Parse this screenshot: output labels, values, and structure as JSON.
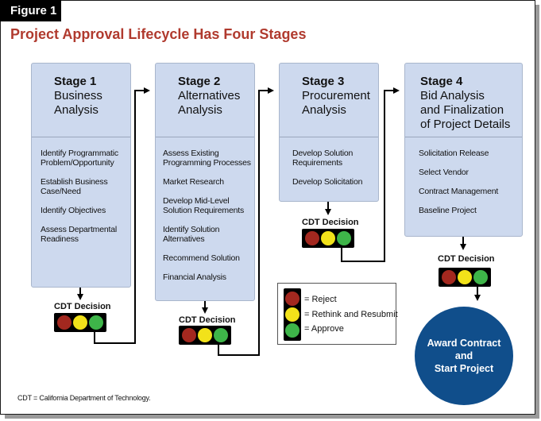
{
  "figure_label": "Figure 1",
  "title": "Project Approval Lifecycle Has Four Stages",
  "stages": [
    {
      "number": "Stage 1",
      "name_lines": [
        "Business",
        "Analysis"
      ],
      "items": [
        "Identify Programmatic Problem/Opportunity",
        "Establish Business Case/Need",
        "Identify Objectives",
        "Assess Departmental Readiness"
      ]
    },
    {
      "number": "Stage 2",
      "name_lines": [
        "Alternatives",
        "Analysis"
      ],
      "items": [
        "Assess Existing Programming Processes",
        "Market Research",
        "Develop Mid-Level Solution Requirements",
        "Identify Solution Alternatives",
        "Recommend Solution",
        "Financial Analysis"
      ]
    },
    {
      "number": "Stage 3",
      "name_lines": [
        "Procurement",
        "Analysis"
      ],
      "items": [
        "Develop Solution Requirements",
        "Develop Solicitation"
      ]
    },
    {
      "number": "Stage 4",
      "name_lines": [
        "Bid Analysis",
        "and Finalization",
        "of Project Details"
      ],
      "items": [
        "Solicitation Release",
        "Select Vendor",
        "Contract Management",
        "Baseline Project"
      ]
    }
  ],
  "decision_label": "CDT Decision",
  "legend": [
    {
      "color": "red",
      "label": "= Reject"
    },
    {
      "color": "yellow",
      "label": "= Rethink and Resubmit"
    },
    {
      "color": "green",
      "label": "= Approve"
    }
  ],
  "colors": {
    "red": "#a3281f",
    "yellow": "#f2e21a",
    "green": "#3eb549",
    "title": "#b03a2e",
    "stage_fill": "#cdd9ee",
    "award_fill": "#104e8b"
  },
  "award": {
    "lines": [
      "Award Contract",
      "and",
      "Start Project"
    ]
  },
  "footnote": "CDT = California Department of Technology."
}
